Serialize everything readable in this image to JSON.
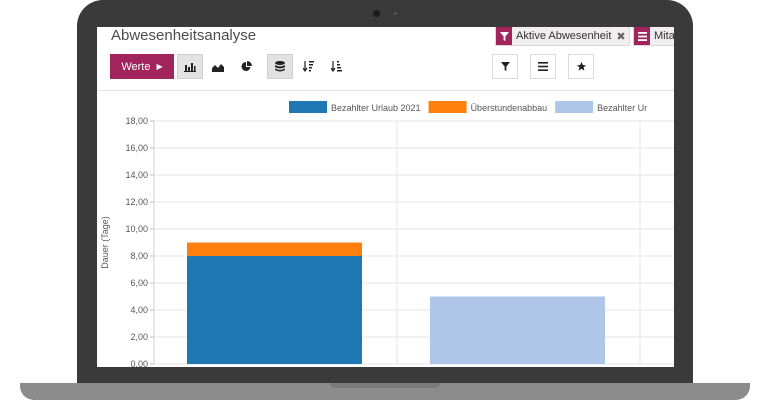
{
  "page": {
    "title": "Abwesenheitsanalyse"
  },
  "search": {
    "facets": [
      {
        "label": "Aktive Abwesenheit",
        "icon": "filter-icon"
      },
      {
        "label": "Mita",
        "icon": "group-icon"
      }
    ]
  },
  "toolbar": {
    "measures_label": "Werte",
    "view_buttons": [
      {
        "icon": "bar-chart-icon",
        "active": true
      },
      {
        "icon": "area-chart-icon",
        "active": false
      },
      {
        "icon": "pie-chart-icon",
        "active": false
      },
      {
        "icon": "stacked-icon",
        "active": true
      },
      {
        "icon": "sort-descending-icon",
        "active": false
      },
      {
        "icon": "sort-ascending-icon",
        "active": false
      }
    ],
    "filter_buttons": [
      {
        "icon": "filter-icon"
      },
      {
        "icon": "list-icon"
      },
      {
        "icon": "star-icon"
      }
    ]
  },
  "colors": {
    "brand": "#a2245c",
    "series_1": "#1f77b4",
    "series_2": "#ff7f0e",
    "series_3": "#aec7e8"
  },
  "chart_data": {
    "type": "bar",
    "stacked": true,
    "ylabel": "Dauer (Tage)",
    "ylim": [
      0,
      18
    ],
    "yticks": [
      "0,00",
      "2,00",
      "4,00",
      "6,00",
      "8,00",
      "10,00",
      "12,00",
      "14,00",
      "16,00",
      "18,00"
    ],
    "grid": true,
    "legend_position": "top",
    "series": [
      {
        "name": "Bezahlter Urlaub 2021",
        "color": "#1f77b4",
        "values": [
          8,
          0,
          0
        ]
      },
      {
        "name": "Überstundenabbau",
        "color": "#ff7f0e",
        "values": [
          1,
          0,
          0
        ]
      },
      {
        "name": "Bezahlter Ur",
        "color": "#aec7e8",
        "values": [
          0,
          5,
          0
        ]
      }
    ]
  }
}
